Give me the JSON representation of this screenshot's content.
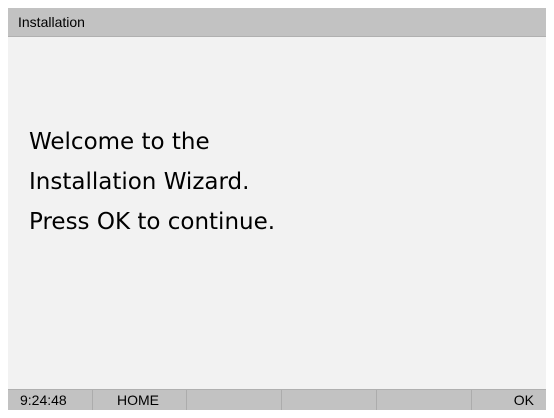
{
  "window": {
    "title": "Installation"
  },
  "message": {
    "lines": [
      "Welcome to the",
      "Installation Wizard.",
      "Press OK to continue."
    ]
  },
  "status_bar": {
    "time": "9:24:48",
    "home_label": "HOME",
    "ok_label": "OK"
  },
  "colors": {
    "screen_background": "#f2f2f2",
    "bar_background": "#c2c2c2",
    "text": "#000000"
  }
}
